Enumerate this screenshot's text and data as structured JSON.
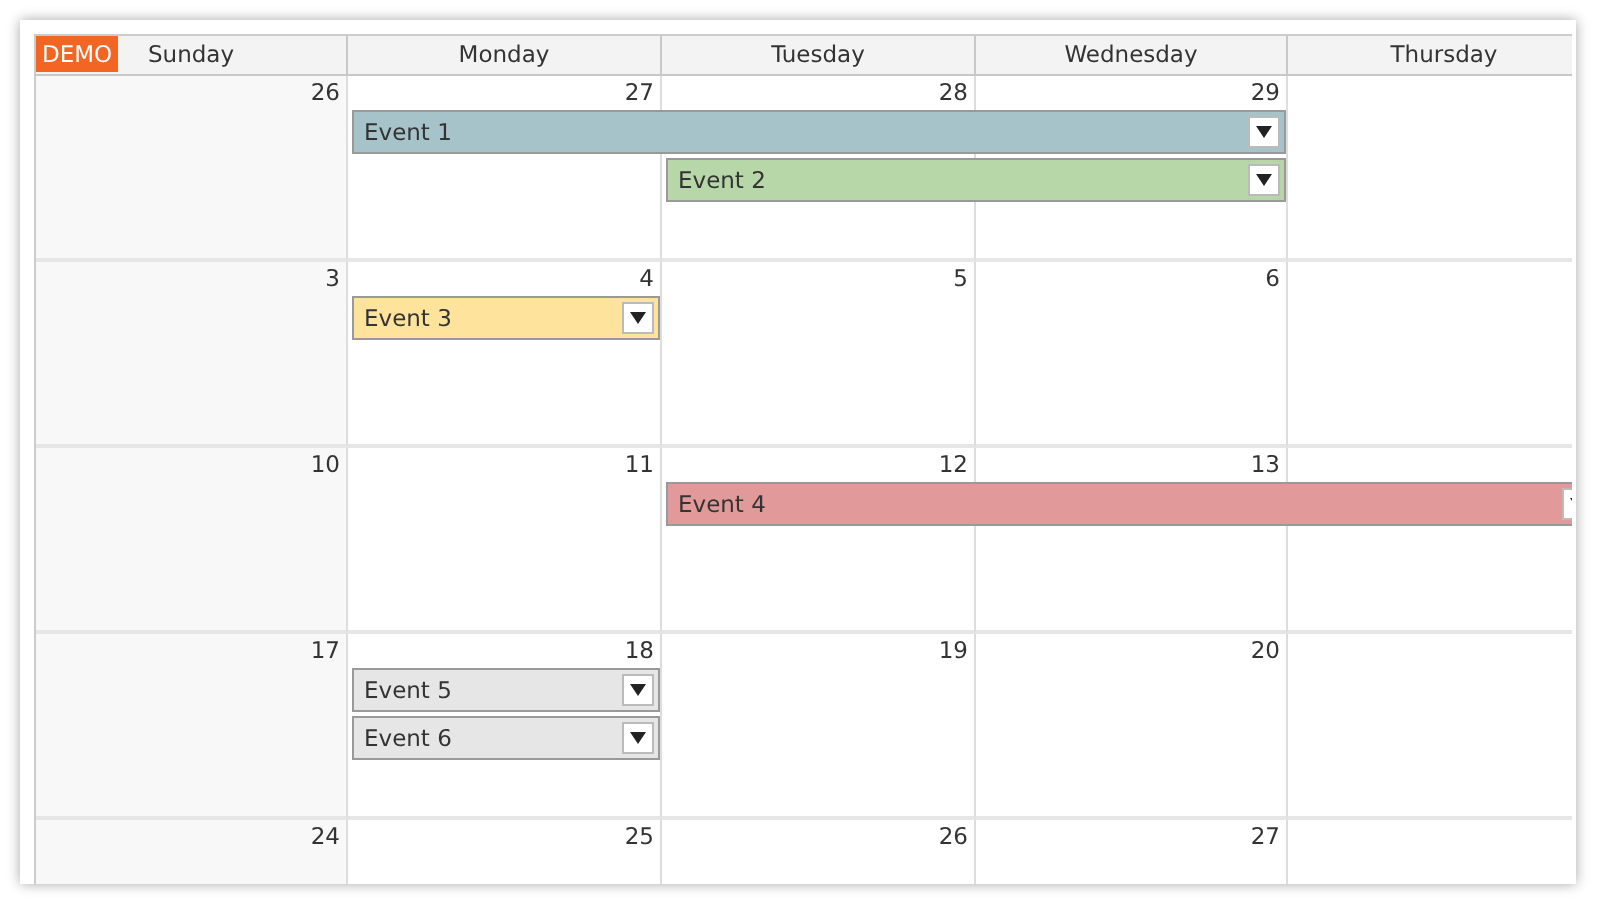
{
  "badge": "DEMO",
  "days": [
    "Sunday",
    "Monday",
    "Tuesday",
    "Wednesday",
    "Thursday"
  ],
  "weeks": [
    {
      "dates": [
        "26",
        "27",
        "28",
        "29"
      ],
      "lanes": [
        {
          "label": "Event 1",
          "color": "#a6c3c9",
          "days": [
            false,
            true,
            true,
            true,
            false
          ]
        },
        {
          "label": "Event 2",
          "color": "#b7d7a8",
          "days": [
            false,
            false,
            true,
            true,
            false
          ]
        }
      ]
    },
    {
      "dates": [
        "3",
        "4",
        "5",
        "6"
      ],
      "lanes": [
        {
          "label": "Event 3",
          "color": "#fde39b",
          "days": [
            false,
            true,
            false,
            false,
            false
          ]
        }
      ]
    },
    {
      "dates": [
        "10",
        "11",
        "12",
        "13"
      ],
      "lanes": [
        {
          "label": "Event 4",
          "color": "#e29999",
          "days": [
            false,
            false,
            true,
            true,
            true
          ]
        }
      ]
    },
    {
      "dates": [
        "17",
        "18",
        "19",
        "20"
      ],
      "lanes": [
        {
          "label": "Event 5",
          "color": "#e6e6e6",
          "days": [
            false,
            true,
            false,
            false,
            false
          ]
        },
        {
          "label": "Event 6",
          "color": "#e6e6e6",
          "days": [
            false,
            true,
            false,
            false,
            false
          ]
        }
      ]
    },
    {
      "dates": [
        "24",
        "25",
        "26",
        "27"
      ]
    }
  ]
}
